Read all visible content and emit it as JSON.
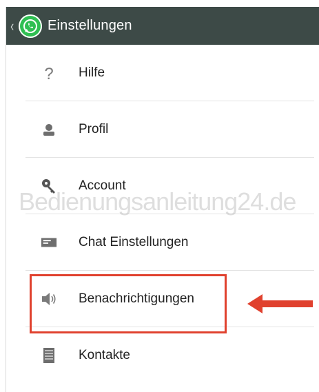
{
  "header": {
    "back_glyph": "‹",
    "title": "Einstellungen"
  },
  "menu": {
    "items": [
      {
        "label": "Hilfe",
        "icon": "help-icon"
      },
      {
        "label": "Profil",
        "icon": "profile-icon"
      },
      {
        "label": "Account",
        "icon": "key-icon"
      },
      {
        "label": "Chat Einstellungen",
        "icon": "chat-settings-icon"
      },
      {
        "label": "Benachrichtigungen",
        "icon": "speaker-icon"
      },
      {
        "label": "Kontakte",
        "icon": "contacts-icon"
      }
    ]
  },
  "watermark": "Bedienungsanleitung24.de",
  "colors": {
    "header_bg": "#3d4a47",
    "whatsapp_green": "#2fbf52",
    "highlight": "#e0412e"
  }
}
